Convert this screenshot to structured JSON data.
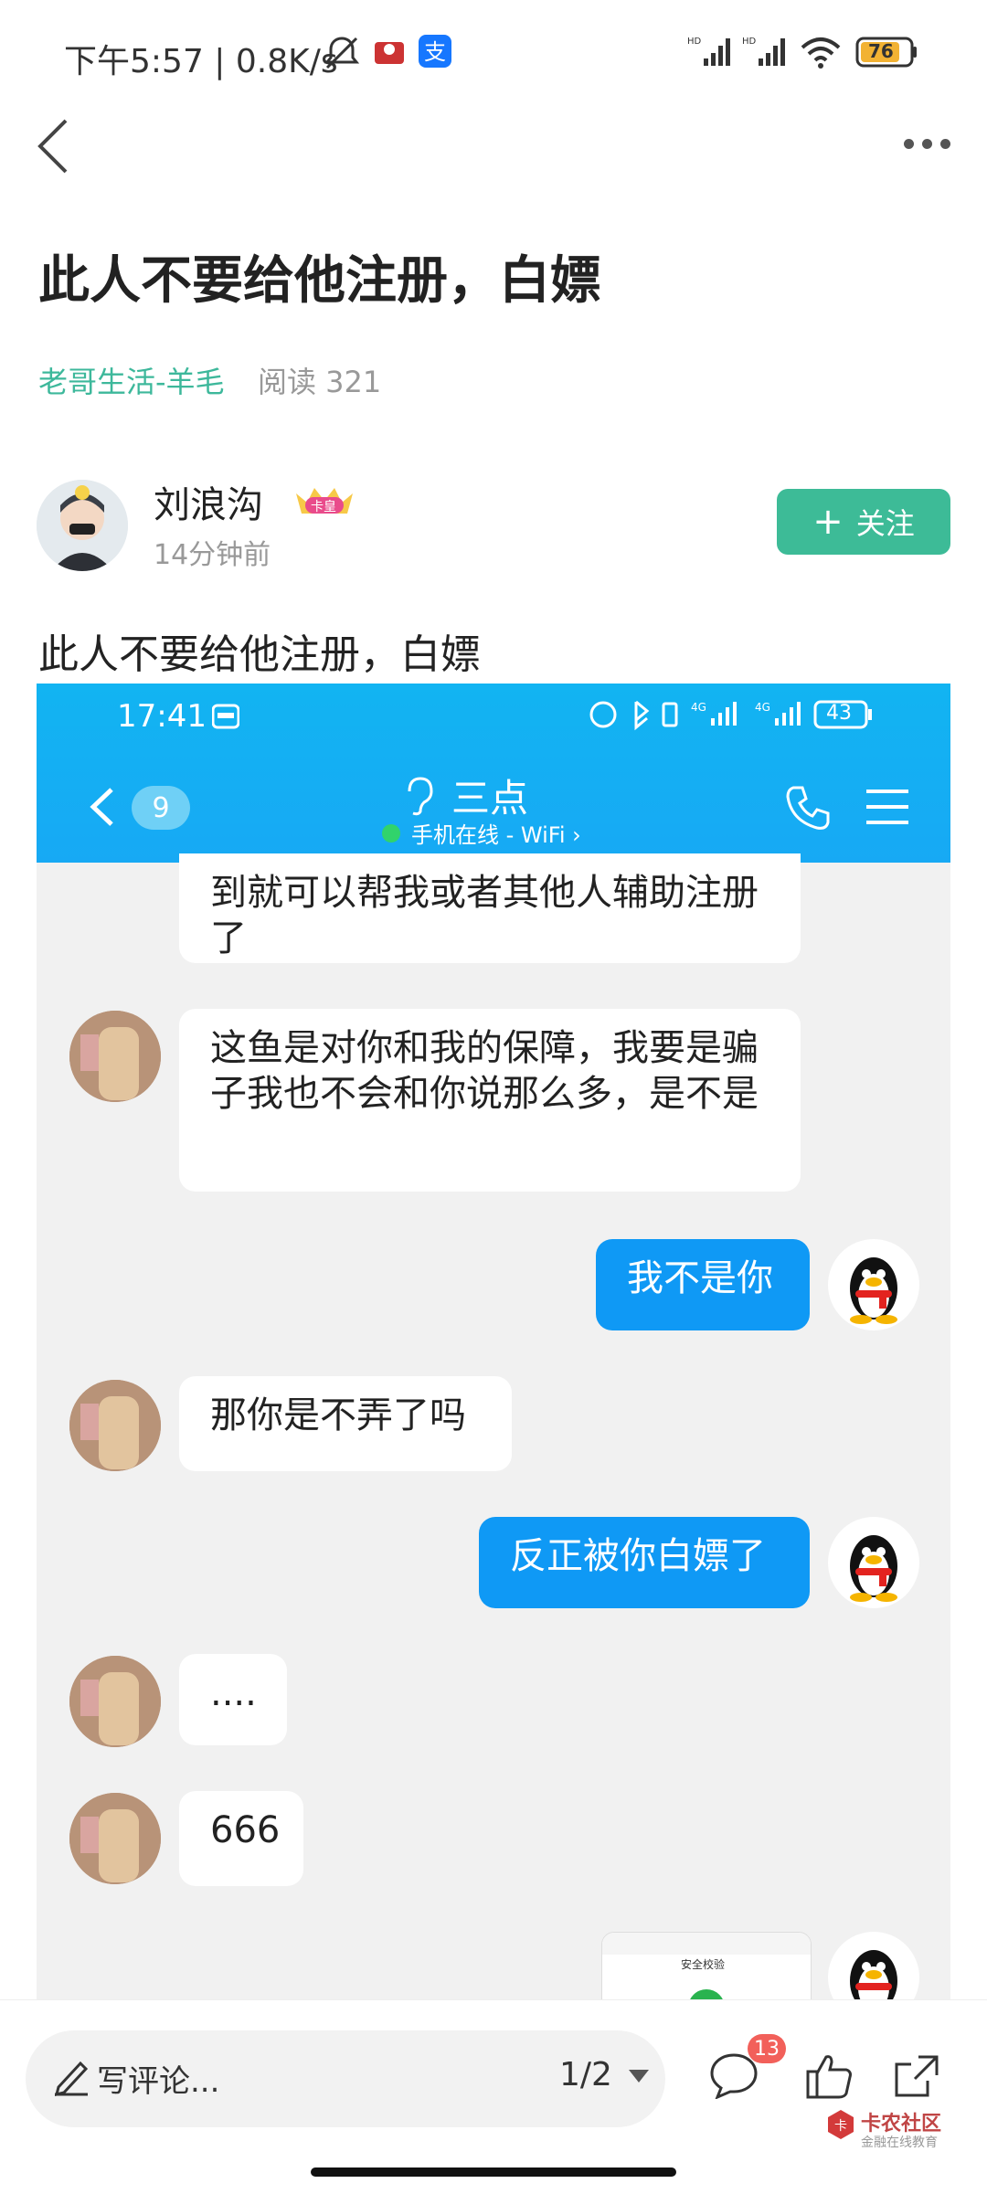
{
  "status_bar": {
    "time": "下午5:57 | 0.8K/s",
    "battery": "76",
    "signal_label_1": "HD",
    "signal_label_2": "HD"
  },
  "post": {
    "title": "此人不要给他注册，白嫖",
    "category": "老哥生活-羊毛",
    "reads": "阅读 321",
    "author_name": "刘浪沟",
    "author_badge": "卡皇",
    "time_ago": "14分钟前",
    "follow_label": "关注",
    "body": "此人不要给他注册，白嫖"
  },
  "screenshot": {
    "time": "17:41",
    "battery": "43",
    "back_count": "9",
    "contact_name": "三点",
    "online_status": "手机在线 - WiFi ›",
    "messages": [
      {
        "side": "left",
        "text": "到就可以帮我或者其他人辅助注册了"
      },
      {
        "side": "left",
        "text": "这鱼是对你和我的保障，我要是骗子我也不会和你说那么多，是不是"
      },
      {
        "side": "right",
        "text": "我不是你"
      },
      {
        "side": "left",
        "text": "那你是不弄了吗"
      },
      {
        "side": "right",
        "text": "反正被你白嫖了"
      },
      {
        "side": "left",
        "text": "...."
      },
      {
        "side": "left",
        "text": "666"
      }
    ],
    "thumb_title": "安全校验"
  },
  "bottom_bar": {
    "comment_placeholder": "写评论...",
    "page_indicator": "1/2",
    "comment_count": "13",
    "watermark": "卡农社区",
    "watermark_sub": "金融在线教育"
  }
}
